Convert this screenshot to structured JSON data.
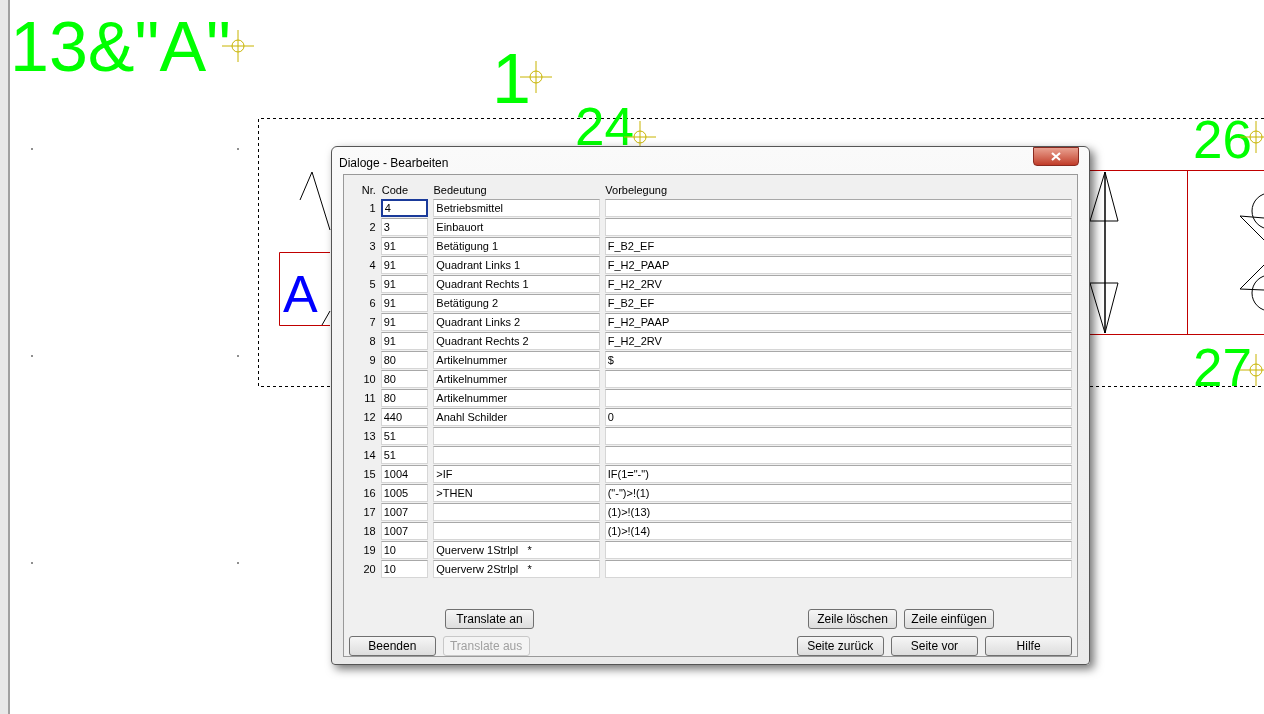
{
  "canvas": {
    "labels": [
      {
        "text": "13&\"A\"",
        "kind": "green"
      },
      {
        "text": "1",
        "kind": "green"
      },
      {
        "text": "24",
        "kind": "green"
      },
      {
        "text": "26",
        "kind": "green"
      },
      {
        "text": "27",
        "kind": "green"
      },
      {
        "text": "A",
        "kind": "blue"
      }
    ]
  },
  "dialog": {
    "title": "Dialoge - Bearbeiten",
    "columns": [
      "Nr.",
      "Code",
      "Bedeutung",
      "Vorbelegung"
    ],
    "rows": [
      {
        "nr": "1",
        "code": "4",
        "bedeutung": "Betriebsmittel",
        "vorbelegung": "",
        "focused": true
      },
      {
        "nr": "2",
        "code": "3",
        "bedeutung": "Einbauort",
        "vorbelegung": "",
        "focused": false
      },
      {
        "nr": "3",
        "code": "91",
        "bedeutung": "Betätigung 1",
        "vorbelegung": "F_B2_EF",
        "focused": false
      },
      {
        "nr": "4",
        "code": "91",
        "bedeutung": "Quadrant Links 1",
        "vorbelegung": "F_H2_PAAP",
        "focused": false
      },
      {
        "nr": "5",
        "code": "91",
        "bedeutung": "Quadrant Rechts 1",
        "vorbelegung": "F_H2_2RV",
        "focused": false
      },
      {
        "nr": "6",
        "code": "91",
        "bedeutung": "Betätigung 2",
        "vorbelegung": "F_B2_EF",
        "focused": false
      },
      {
        "nr": "7",
        "code": "91",
        "bedeutung": "Quadrant Links 2",
        "vorbelegung": "F_H2_PAAP",
        "focused": false
      },
      {
        "nr": "8",
        "code": "91",
        "bedeutung": "Quadrant Rechts 2",
        "vorbelegung": "F_H2_2RV",
        "focused": false
      },
      {
        "nr": "9",
        "code": "80",
        "bedeutung": "Artikelnummer",
        "vorbelegung": "$",
        "focused": false
      },
      {
        "nr": "10",
        "code": "80",
        "bedeutung": "Artikelnummer",
        "vorbelegung": "",
        "focused": false
      },
      {
        "nr": "11",
        "code": "80",
        "bedeutung": "Artikelnummer",
        "vorbelegung": "",
        "focused": false
      },
      {
        "nr": "12",
        "code": "440",
        "bedeutung": "Anahl Schilder",
        "vorbelegung": "0",
        "focused": false
      },
      {
        "nr": "13",
        "code": "51",
        "bedeutung": "",
        "vorbelegung": "",
        "focused": false
      },
      {
        "nr": "14",
        "code": "51",
        "bedeutung": "",
        "vorbelegung": "",
        "focused": false
      },
      {
        "nr": "15",
        "code": "1004",
        "bedeutung": ">IF",
        "vorbelegung": "IF(1=\"-\")",
        "focused": false
      },
      {
        "nr": "16",
        "code": "1005",
        "bedeutung": ">THEN",
        "vorbelegung": "(\"-\")>!(1)",
        "focused": false
      },
      {
        "nr": "17",
        "code": "1007",
        "bedeutung": "",
        "vorbelegung": "(1)>!(13)",
        "focused": false
      },
      {
        "nr": "18",
        "code": "1007",
        "bedeutung": "",
        "vorbelegung": "(1)>!(14)",
        "focused": false
      },
      {
        "nr": "19",
        "code": "10",
        "bedeutung": "Querverw 1Strlpl   *",
        "vorbelegung": "",
        "focused": false
      },
      {
        "nr": "20",
        "code": "10",
        "bedeutung": "Querverw 2Strlpl   *",
        "vorbelegung": "",
        "focused": false
      }
    ],
    "buttons": [
      {
        "label": "Translate an",
        "disabled": false
      },
      {
        "label": "Zeile löschen",
        "disabled": false
      },
      {
        "label": "Zeile einfügen",
        "disabled": false
      },
      {
        "label": "Beenden",
        "disabled": false
      },
      {
        "label": "Translate aus",
        "disabled": true
      },
      {
        "label": "Seite zurück",
        "disabled": false
      },
      {
        "label": "Seite vor",
        "disabled": false
      },
      {
        "label": "Hilfe",
        "disabled": false
      }
    ]
  }
}
